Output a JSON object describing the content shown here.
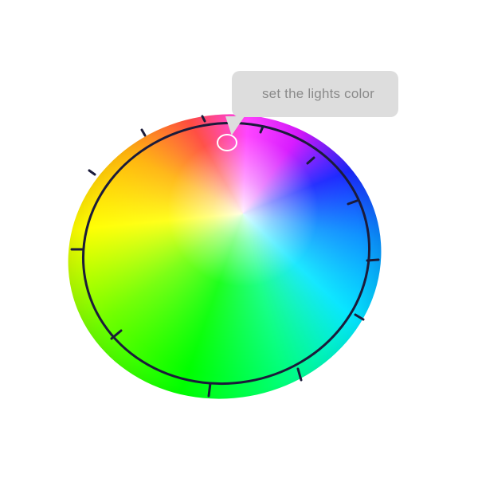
{
  "tooltip": {
    "text": "set the lights color",
    "background": "#dddddd",
    "text_color": "#8a8a8a"
  },
  "color_wheel": {
    "hue_stops": [
      "#ff3b30",
      "#ff2dff",
      "#d300ff",
      "#0a16ff",
      "#008cff",
      "#00e5ff",
      "#00ff7a",
      "#00ff00",
      "#6fff00",
      "#ffff00",
      "#ffb000",
      "#ff3b30"
    ],
    "ring_outline_color": "#1b1b3a",
    "segment_divider_color": "#1b1b3a",
    "selected_hue": "magenta",
    "selected_color": "#ff2dff"
  }
}
